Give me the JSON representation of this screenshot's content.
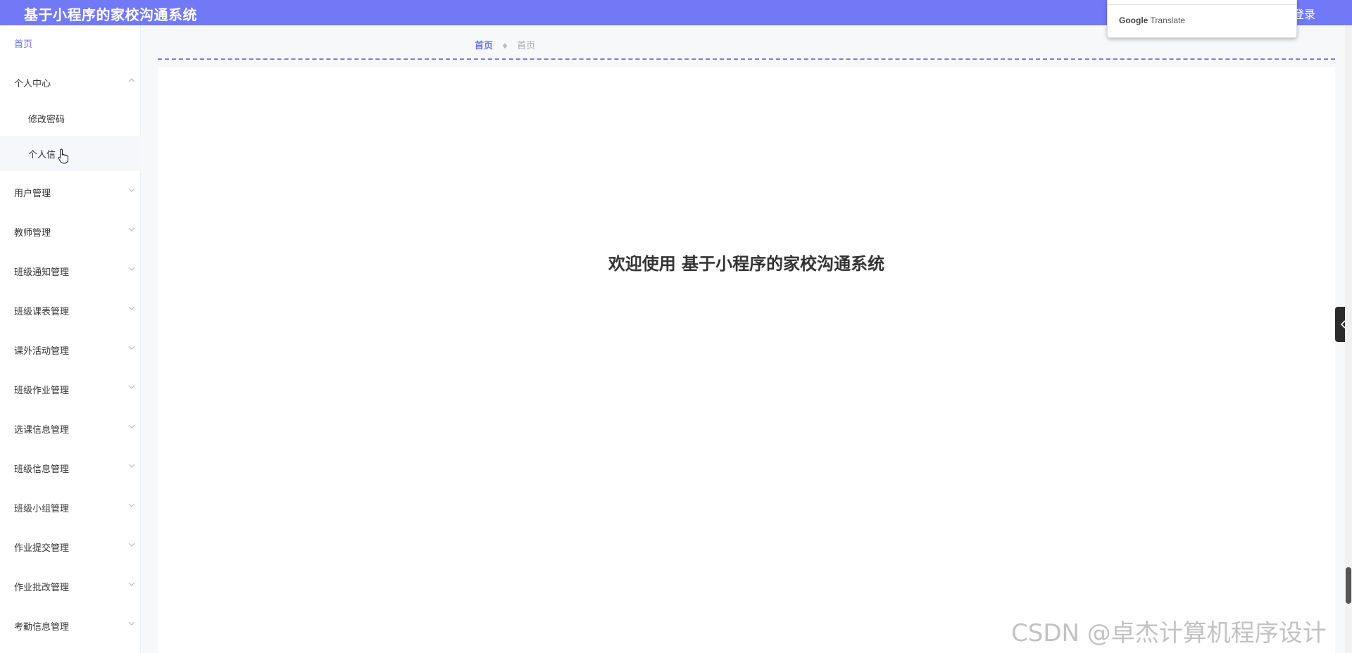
{
  "header": {
    "app_title": "基于小程序的家校沟通系统",
    "logout_label": "登录"
  },
  "translate_popup": {
    "brand_google": "Google",
    "brand_translate": "Translate"
  },
  "sidebar": {
    "items": [
      {
        "label": "首页",
        "active": true
      },
      {
        "label": "个人中心",
        "expanded": true
      },
      {
        "label": "修改密码"
      },
      {
        "label": "个人信"
      },
      {
        "label": "用户管理"
      },
      {
        "label": "教师管理"
      },
      {
        "label": "班级通知管理"
      },
      {
        "label": "班级课表管理"
      },
      {
        "label": "课外活动管理"
      },
      {
        "label": "班级作业管理"
      },
      {
        "label": "选课信息管理"
      },
      {
        "label": "班级信息管理"
      },
      {
        "label": "班级小组管理"
      },
      {
        "label": "作业提交管理"
      },
      {
        "label": "作业批改管理"
      },
      {
        "label": "考勤信息管理"
      }
    ]
  },
  "breadcrumb": {
    "items": [
      "首页",
      "首页"
    ],
    "separator": "♦"
  },
  "main": {
    "welcome": "欢迎使用 基于小程序的家校沟通系统"
  },
  "watermark": "CSDN @卓杰计算机程序设计",
  "colors": {
    "accent": "#7279f7",
    "active_link": "#6c73f3"
  }
}
